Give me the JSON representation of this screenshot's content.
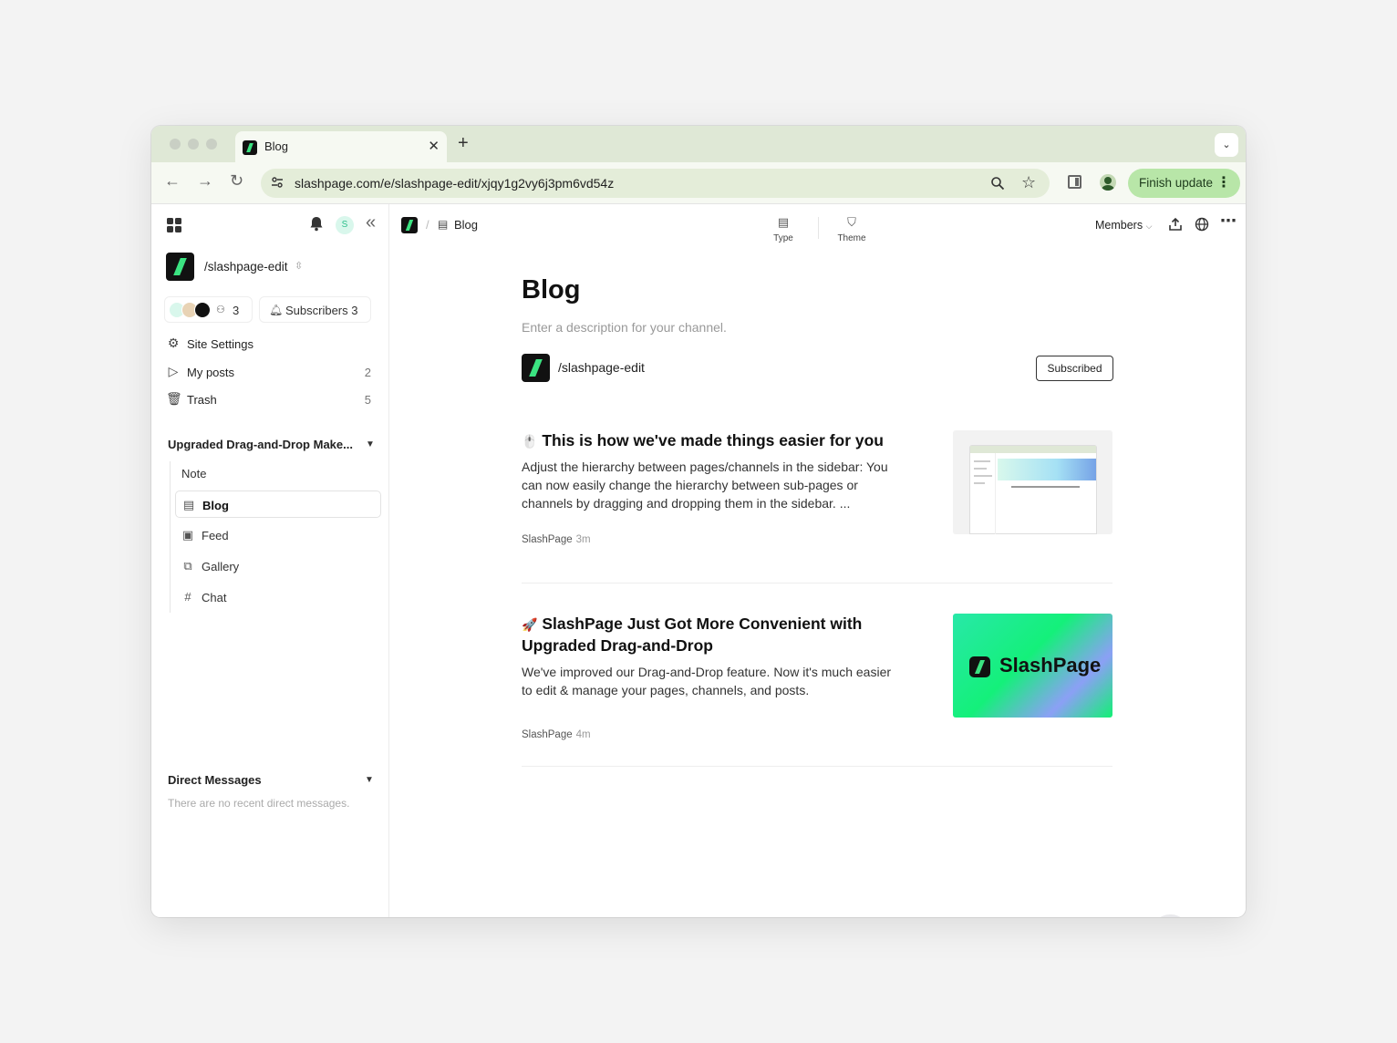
{
  "browser": {
    "tab_title": "Blog",
    "tab_close": "✕",
    "new_tab": "+",
    "tab_menu": "⌄",
    "url": "slashpage.com/e/slashpage-edit/xjqy1g2vy6j3pm6vd54z",
    "finish_update": "Finish update",
    "icons": [
      "back-icon",
      "forward-icon",
      "reload-icon",
      "site-settings-icon",
      "zoom-icon",
      "bookmark-star-icon",
      "side-panel-icon",
      "profile-icon",
      "kebab-menu-icon"
    ]
  },
  "sidebar": {
    "avatar_letter": "S",
    "site_name": "/slashpage-edit",
    "members_count": "3",
    "subscribers_label": "Subscribers",
    "subscribers_count": "3",
    "menu": [
      {
        "label": "Site Settings",
        "count": ""
      },
      {
        "label": "My posts",
        "count": "2"
      },
      {
        "label": "Trash",
        "count": "5"
      }
    ],
    "section_title": "Upgraded Drag-and-Drop Make...",
    "tree": [
      {
        "label": "Note"
      },
      {
        "label": "Blog"
      },
      {
        "label": "Feed"
      },
      {
        "label": "Gallery"
      },
      {
        "label": "Chat"
      }
    ],
    "dm_title": "Direct Messages",
    "dm_empty": "There are no recent direct messages."
  },
  "main": {
    "breadcrumb_slash": "/",
    "breadcrumb_title": "Blog",
    "tools": [
      {
        "label": "Type"
      },
      {
        "label": "Theme"
      }
    ],
    "members_label": "Members",
    "page_title": "Blog",
    "page_description": "Enter a description for your channel.",
    "channel_name": "/slashpage-edit",
    "subscribed_label": "Subscribed",
    "posts": [
      {
        "emoji": "🖱️",
        "title": "This is how we've made things easier for you",
        "body": "Adjust the hierarchy between pages/channels in the sidebar: You can now easily change the hierarchy between sub-pages or channels by dragging and dropping them in the sidebar. ...",
        "author": "SlashPage",
        "ago": "3m"
      },
      {
        "emoji": "🚀",
        "title": "SlashPage Just Got More Convenient with Upgraded Drag-and-Drop",
        "body": "We've improved our Drag-and-Drop feature. Now it's much easier to edit & manage your pages, channels, and posts.",
        "author": "SlashPage",
        "ago": "4m",
        "thumb_text": "SlashPage"
      }
    ],
    "help_label": "?",
    "add_label": "+"
  },
  "colors": {
    "brand_green": "#3be381",
    "finish_update_bg": "#b8e6a8",
    "tab_strip": "#dfe8d6"
  }
}
